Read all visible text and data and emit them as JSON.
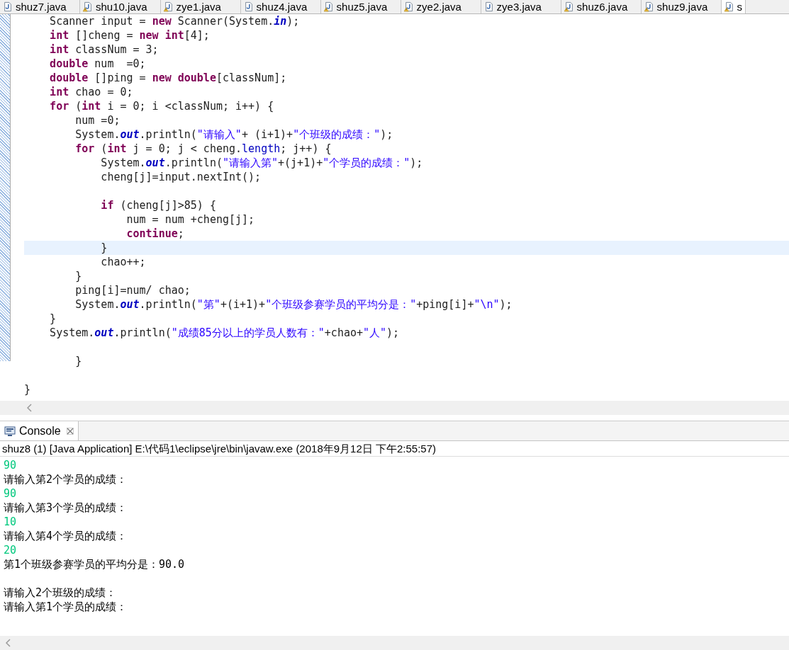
{
  "editor_tabs": [
    {
      "label": "shuz7.java",
      "warning": false,
      "selected": false
    },
    {
      "label": "shu10.java",
      "warning": true,
      "selected": false
    },
    {
      "label": "zye1.java",
      "warning": true,
      "selected": false
    },
    {
      "label": "shuz4.java",
      "warning": false,
      "selected": false
    },
    {
      "label": "shuz5.java",
      "warning": true,
      "selected": false
    },
    {
      "label": "zye2.java",
      "warning": true,
      "selected": false
    },
    {
      "label": "zye3.java",
      "warning": false,
      "selected": false
    },
    {
      "label": "shuz6.java",
      "warning": true,
      "selected": false
    },
    {
      "label": "shuz9.java",
      "warning": true,
      "selected": false
    },
    {
      "label": "s",
      "warning": true,
      "selected": true
    }
  ],
  "code_lines": [
    {
      "kind": "code",
      "current": false,
      "tokens": [
        {
          "kind": "plain",
          "text": "    Scanner input = "
        },
        {
          "kind": "keyword",
          "text": "new"
        },
        {
          "kind": "plain",
          "text": " Scanner(System."
        },
        {
          "kind": "static",
          "text": "in"
        },
        {
          "kind": "plain",
          "text": ");"
        }
      ]
    },
    {
      "kind": "code",
      "current": false,
      "tokens": [
        {
          "kind": "keyword",
          "text": "    int"
        },
        {
          "kind": "plain",
          "text": " []cheng = "
        },
        {
          "kind": "keyword",
          "text": "new"
        },
        {
          "kind": "keyword",
          "text": " int"
        },
        {
          "kind": "plain",
          "text": "[4];"
        }
      ]
    },
    {
      "kind": "code",
      "current": false,
      "tokens": [
        {
          "kind": "keyword",
          "text": "    int"
        },
        {
          "kind": "plain",
          "text": " classNum = 3;"
        }
      ]
    },
    {
      "kind": "code",
      "current": false,
      "tokens": [
        {
          "kind": "keyword",
          "text": "    double"
        },
        {
          "kind": "plain",
          "text": " num  =0;"
        }
      ]
    },
    {
      "kind": "code",
      "current": false,
      "tokens": [
        {
          "kind": "keyword",
          "text": "    double"
        },
        {
          "kind": "plain",
          "text": " []ping = "
        },
        {
          "kind": "keyword",
          "text": "new"
        },
        {
          "kind": "keyword",
          "text": " double"
        },
        {
          "kind": "plain",
          "text": "[classNum];"
        }
      ]
    },
    {
      "kind": "code",
      "current": false,
      "tokens": [
        {
          "kind": "keyword",
          "text": "    int"
        },
        {
          "kind": "plain",
          "text": " chao = 0;"
        }
      ]
    },
    {
      "kind": "code",
      "current": false,
      "tokens": [
        {
          "kind": "keyword",
          "text": "    for"
        },
        {
          "kind": "plain",
          "text": " ("
        },
        {
          "kind": "keyword",
          "text": "int"
        },
        {
          "kind": "plain",
          "text": " i = 0; i <classNum; i++) {"
        }
      ]
    },
    {
      "kind": "code",
      "current": false,
      "tokens": [
        {
          "kind": "plain",
          "text": "        num =0;"
        }
      ]
    },
    {
      "kind": "code",
      "current": false,
      "tokens": [
        {
          "kind": "plain",
          "text": "        System."
        },
        {
          "kind": "static",
          "text": "out"
        },
        {
          "kind": "plain",
          "text": ".println("
        },
        {
          "kind": "string",
          "text": "\"请输入\""
        },
        {
          "kind": "plain",
          "text": "+ (i+1)+"
        },
        {
          "kind": "string",
          "text": "\"个班级的成绩：\""
        },
        {
          "kind": "plain",
          "text": ");"
        }
      ]
    },
    {
      "kind": "code",
      "current": false,
      "tokens": [
        {
          "kind": "keyword",
          "text": "        for"
        },
        {
          "kind": "plain",
          "text": " ("
        },
        {
          "kind": "keyword",
          "text": "int"
        },
        {
          "kind": "plain",
          "text": " j = 0; j < cheng."
        },
        {
          "kind": "field",
          "text": "length"
        },
        {
          "kind": "plain",
          "text": "; j++) {"
        }
      ]
    },
    {
      "kind": "code",
      "current": false,
      "tokens": [
        {
          "kind": "plain",
          "text": "            System."
        },
        {
          "kind": "static",
          "text": "out"
        },
        {
          "kind": "plain",
          "text": ".println("
        },
        {
          "kind": "string",
          "text": "\"请输入第\""
        },
        {
          "kind": "plain",
          "text": "+(j+1)+"
        },
        {
          "kind": "string",
          "text": "\"个学员的成绩：\""
        },
        {
          "kind": "plain",
          "text": ");"
        }
      ]
    },
    {
      "kind": "code",
      "current": false,
      "tokens": [
        {
          "kind": "plain",
          "text": "            cheng[j]=input.nextInt();"
        }
      ]
    },
    {
      "kind": "blank",
      "current": false
    },
    {
      "kind": "code",
      "current": false,
      "tokens": [
        {
          "kind": "keyword",
          "text": "            if"
        },
        {
          "kind": "plain",
          "text": " (cheng[j]>85) {"
        }
      ]
    },
    {
      "kind": "code",
      "current": false,
      "tokens": [
        {
          "kind": "plain",
          "text": "                num = num +cheng[j];"
        }
      ]
    },
    {
      "kind": "code",
      "current": false,
      "tokens": [
        {
          "kind": "keyword",
          "text": "                continue"
        },
        {
          "kind": "plain",
          "text": ";"
        }
      ]
    },
    {
      "kind": "code",
      "current": true,
      "tokens": [
        {
          "kind": "plain",
          "text": "            }"
        }
      ]
    },
    {
      "kind": "code",
      "current": false,
      "tokens": [
        {
          "kind": "plain",
          "text": "            chao++;"
        }
      ]
    },
    {
      "kind": "code",
      "current": false,
      "tokens": [
        {
          "kind": "plain",
          "text": "        }"
        }
      ]
    },
    {
      "kind": "code",
      "current": false,
      "tokens": [
        {
          "kind": "plain",
          "text": "        ping[i]=num/ chao;"
        }
      ]
    },
    {
      "kind": "code",
      "current": false,
      "tokens": [
        {
          "kind": "plain",
          "text": "        System."
        },
        {
          "kind": "static",
          "text": "out"
        },
        {
          "kind": "plain",
          "text": ".println("
        },
        {
          "kind": "string",
          "text": "\"第\""
        },
        {
          "kind": "plain",
          "text": "+(i+1)+"
        },
        {
          "kind": "string",
          "text": "\"个班级参赛学员的平均分是：\""
        },
        {
          "kind": "plain",
          "text": "+ping[i]+"
        },
        {
          "kind": "string",
          "text": "\"\\n\""
        },
        {
          "kind": "plain",
          "text": ");"
        }
      ]
    },
    {
      "kind": "code",
      "current": false,
      "tokens": [
        {
          "kind": "plain",
          "text": "    }"
        }
      ]
    },
    {
      "kind": "code",
      "current": false,
      "tokens": [
        {
          "kind": "plain",
          "text": "    System."
        },
        {
          "kind": "static",
          "text": "out"
        },
        {
          "kind": "plain",
          "text": ".println("
        },
        {
          "kind": "string",
          "text": "\"成绩85分以上的学员人数有：\""
        },
        {
          "kind": "plain",
          "text": "+chao+"
        },
        {
          "kind": "string",
          "text": "\"人\""
        },
        {
          "kind": "plain",
          "text": ");"
        }
      ]
    },
    {
      "kind": "blank",
      "current": false
    },
    {
      "kind": "code",
      "current": false,
      "tokens": [
        {
          "kind": "plain",
          "text": "        }"
        }
      ]
    },
    {
      "kind": "blank",
      "current": false
    },
    {
      "kind": "code",
      "current": false,
      "tokens": [
        {
          "kind": "plain",
          "text": "}"
        }
      ]
    }
  ],
  "console": {
    "tab": "Console",
    "header": "shuz8 (1) [Java Application] E:\\代码1\\eclipse\\jre\\bin\\javaw.exe (2018年9月12日 下午2:55:57)",
    "lines": [
      {
        "kind": "input",
        "text": "90"
      },
      {
        "kind": "output",
        "text": "请输入第2个学员的成绩："
      },
      {
        "kind": "input",
        "text": "90"
      },
      {
        "kind": "output",
        "text": "请输入第3个学员的成绩："
      },
      {
        "kind": "input",
        "text": "10"
      },
      {
        "kind": "output",
        "text": "请输入第4个学员的成绩："
      },
      {
        "kind": "input",
        "text": "20"
      },
      {
        "kind": "output",
        "text": "第1个班级参赛学员的平均分是：90.0"
      },
      {
        "kind": "blank"
      },
      {
        "kind": "output",
        "text": "请输入2个班级的成绩："
      },
      {
        "kind": "output",
        "text": "请输入第1个学员的成绩："
      }
    ]
  }
}
